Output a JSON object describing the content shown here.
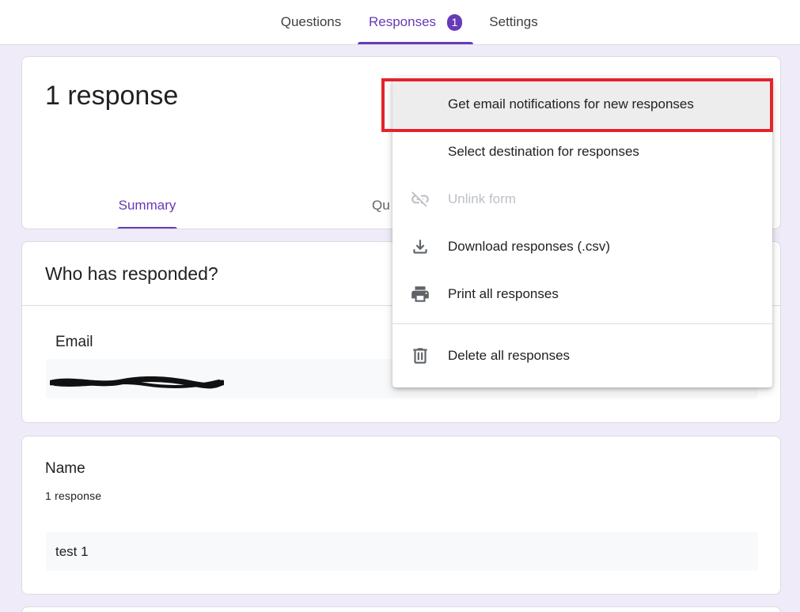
{
  "top_tabs": {
    "questions": "Questions",
    "responses": "Responses",
    "responses_badge": "1",
    "settings": "Settings"
  },
  "summary_card": {
    "count_title": "1 response",
    "tab_summary": "Summary",
    "tab_question": "Qu"
  },
  "respondents_card": {
    "title": "Who has responded?",
    "field_label": "Email"
  },
  "question_card": {
    "title": "Name",
    "count": "1 response",
    "answer": "test 1"
  },
  "menu": {
    "items": [
      {
        "label": "Get email notifications for new responses",
        "icon": "none"
      },
      {
        "label": "Select destination for responses",
        "icon": "none"
      },
      {
        "label": "Unlink form",
        "icon": "link-off-icon"
      },
      {
        "label": "Download responses (.csv)",
        "icon": "download-icon"
      },
      {
        "label": "Print all responses",
        "icon": "print-icon"
      },
      {
        "label": "Delete all responses",
        "icon": "trash-icon"
      }
    ]
  },
  "colors": {
    "accent": "#673ab7",
    "background": "#f0ebf8",
    "highlight_box": "#e3242b"
  }
}
